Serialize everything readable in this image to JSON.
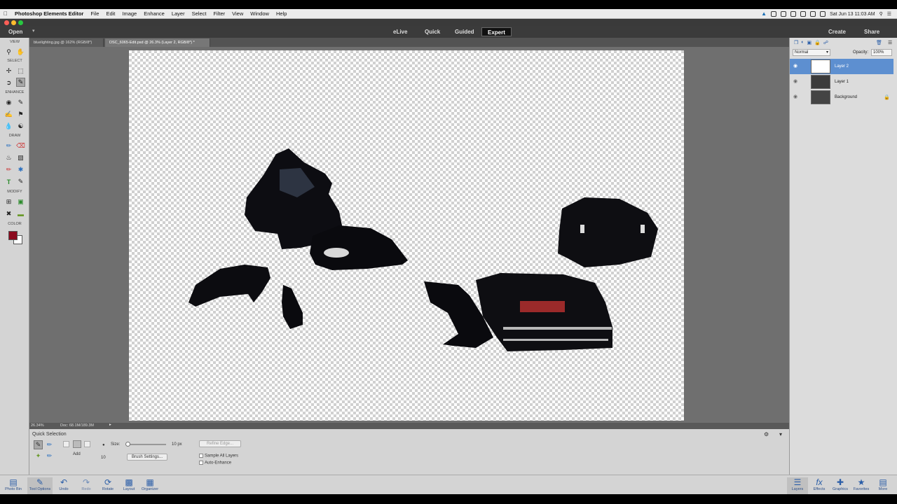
{
  "menubar": {
    "app_name": "Photoshop Elements Editor",
    "items": [
      "File",
      "Edit",
      "Image",
      "Enhance",
      "Layer",
      "Select",
      "Filter",
      "View",
      "Window",
      "Help"
    ],
    "clock": "Sat Jun 13  11:03 AM"
  },
  "modebar": {
    "open_label": "Open",
    "tabs": [
      "eLive",
      "Quick",
      "Guided",
      "Expert"
    ],
    "active_tab": "Expert",
    "create_label": "Create",
    "share_label": "Share"
  },
  "doc_tabs": [
    {
      "label": "bluelighting.jpg @ 162% (RGB/8*)"
    },
    {
      "label": "DSC_6065-Edit.psd @ 26.3% (Layer 2, RGB/8*) *"
    }
  ],
  "toolbox": {
    "sections": [
      "VIEW",
      "SELECT",
      "ENHANCE",
      "DRAW",
      "MODIFY",
      "COLOR"
    ],
    "foreground_color": "#8b0a1e",
    "background_color": "#ffffff"
  },
  "status": {
    "zoom": "26.34%",
    "doc_size": "Doc: 68.1M/189.3M"
  },
  "tool_options": {
    "tool_name": "Quick Selection",
    "mode_label": "Add",
    "size_label": "Size:",
    "size_value": "10 px",
    "size_number": "10",
    "brush_settings_label": "Brush Settings...",
    "refine_edge_label": "Refine Edge...",
    "sample_all_layers_label": "Sample All Layers",
    "auto_enhance_label": "Auto-Enhance",
    "size_slider_level": 0.02
  },
  "layers_panel": {
    "blend_mode": "Normal",
    "opacity_label": "Opacity:",
    "opacity_value": "100%",
    "layers": [
      {
        "name": "Layer 2",
        "selected": true
      },
      {
        "name": "Layer 1",
        "selected": false
      },
      {
        "name": "Background",
        "selected": false
      }
    ]
  },
  "taskbar": {
    "left": [
      "Photo Bin",
      "Tool Options",
      "Undo",
      "Redo",
      "Rotate",
      "Layout",
      "Organizer"
    ],
    "right": [
      "Layers",
      "Effects",
      "Graphics",
      "Favorites",
      "More"
    ]
  }
}
